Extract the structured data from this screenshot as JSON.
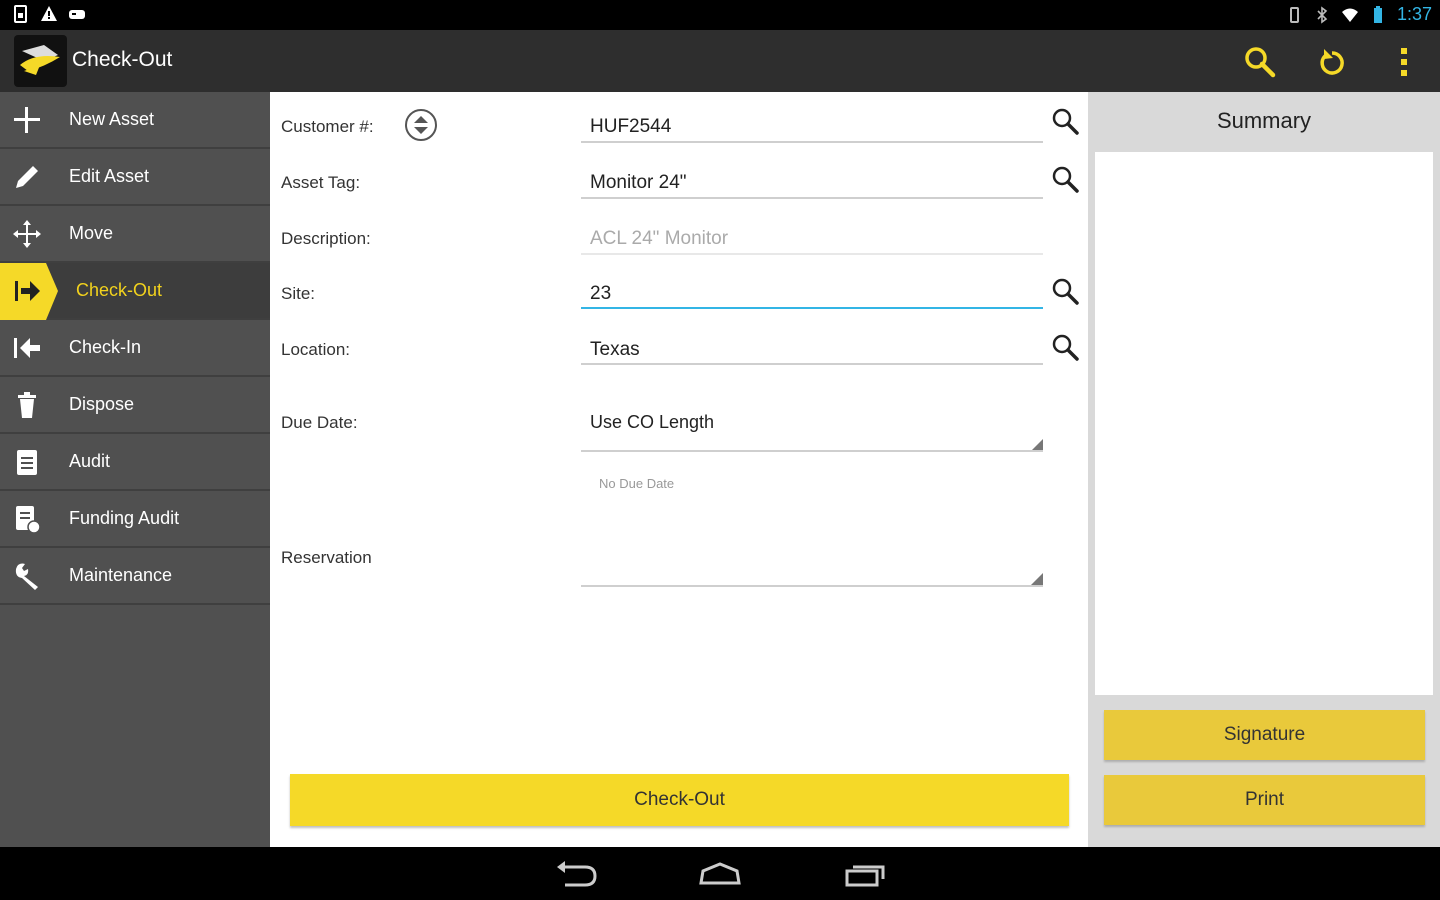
{
  "status": {
    "clock": "1:37"
  },
  "actionbar": {
    "title": "Check-Out",
    "icons": [
      "search-icon",
      "refresh-icon",
      "overflow-menu-icon"
    ]
  },
  "sidebar": {
    "items": [
      {
        "label": "New Asset",
        "icon": "plus-icon"
      },
      {
        "label": "Edit Asset",
        "icon": "pencil-icon"
      },
      {
        "label": "Move",
        "icon": "move-icon"
      },
      {
        "label": "Check-Out",
        "icon": "check-out-icon",
        "active": true
      },
      {
        "label": "Check-In",
        "icon": "check-in-icon"
      },
      {
        "label": "Dispose",
        "icon": "trash-icon"
      },
      {
        "label": "Audit",
        "icon": "clipboard-icon"
      },
      {
        "label": "Funding Audit",
        "icon": "funding-audit-icon"
      },
      {
        "label": "Maintenance",
        "icon": "wrench-icon"
      }
    ]
  },
  "form": {
    "customer_label": "Customer #:",
    "customer_value": "HUF2544",
    "asset_tag_label": "Asset Tag:",
    "asset_tag_value": "Monitor 24\"",
    "description_label": "Description:",
    "description_value": "ACL 24\" Monitor",
    "site_label": "Site:",
    "site_value": "23",
    "location_label": "Location:",
    "location_value": "Texas",
    "due_date_label": "Due Date:",
    "due_date_value": "Use CO Length",
    "no_due_date": "No Due Date",
    "reservation_label": "Reservation",
    "reservation_value": "",
    "submit_label": "Check-Out"
  },
  "summary": {
    "title": "Summary",
    "signature_label": "Signature",
    "print_label": "Print"
  },
  "colors": {
    "accent": "#f5d928",
    "focus": "#33b5e5",
    "sidebar": "#505050",
    "actionbar": "#2e2e2e"
  }
}
